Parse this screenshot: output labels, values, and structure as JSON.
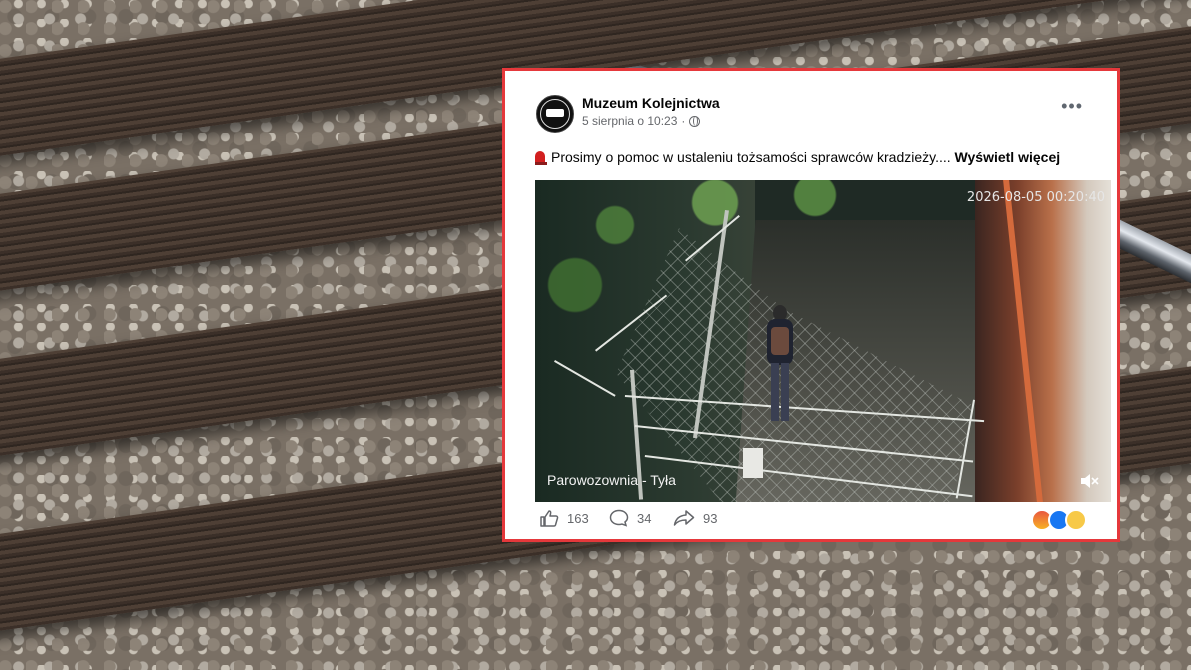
{
  "post": {
    "page_name": "Muzeum Kolejnictwa",
    "date": "5 sierpnia o 10:23",
    "separator": "·",
    "text": "Prosimy o pomoc w ustaleniu tożsamości sprawców kradzieży....",
    "see_more_label": "Wyświetl więcej",
    "media": {
      "timestamp": "2026-08-05 00:20:40",
      "location_label": "Parowozownia - Tyła"
    },
    "stats": {
      "likes": "163",
      "comments": "34",
      "shares": "93"
    },
    "reactions": [
      "angry-icon",
      "like-icon",
      "sad-icon"
    ]
  },
  "colors": {
    "highlight_border": "#e5383b",
    "like_blue": "#1877f2",
    "meta_gray": "#65676b"
  }
}
